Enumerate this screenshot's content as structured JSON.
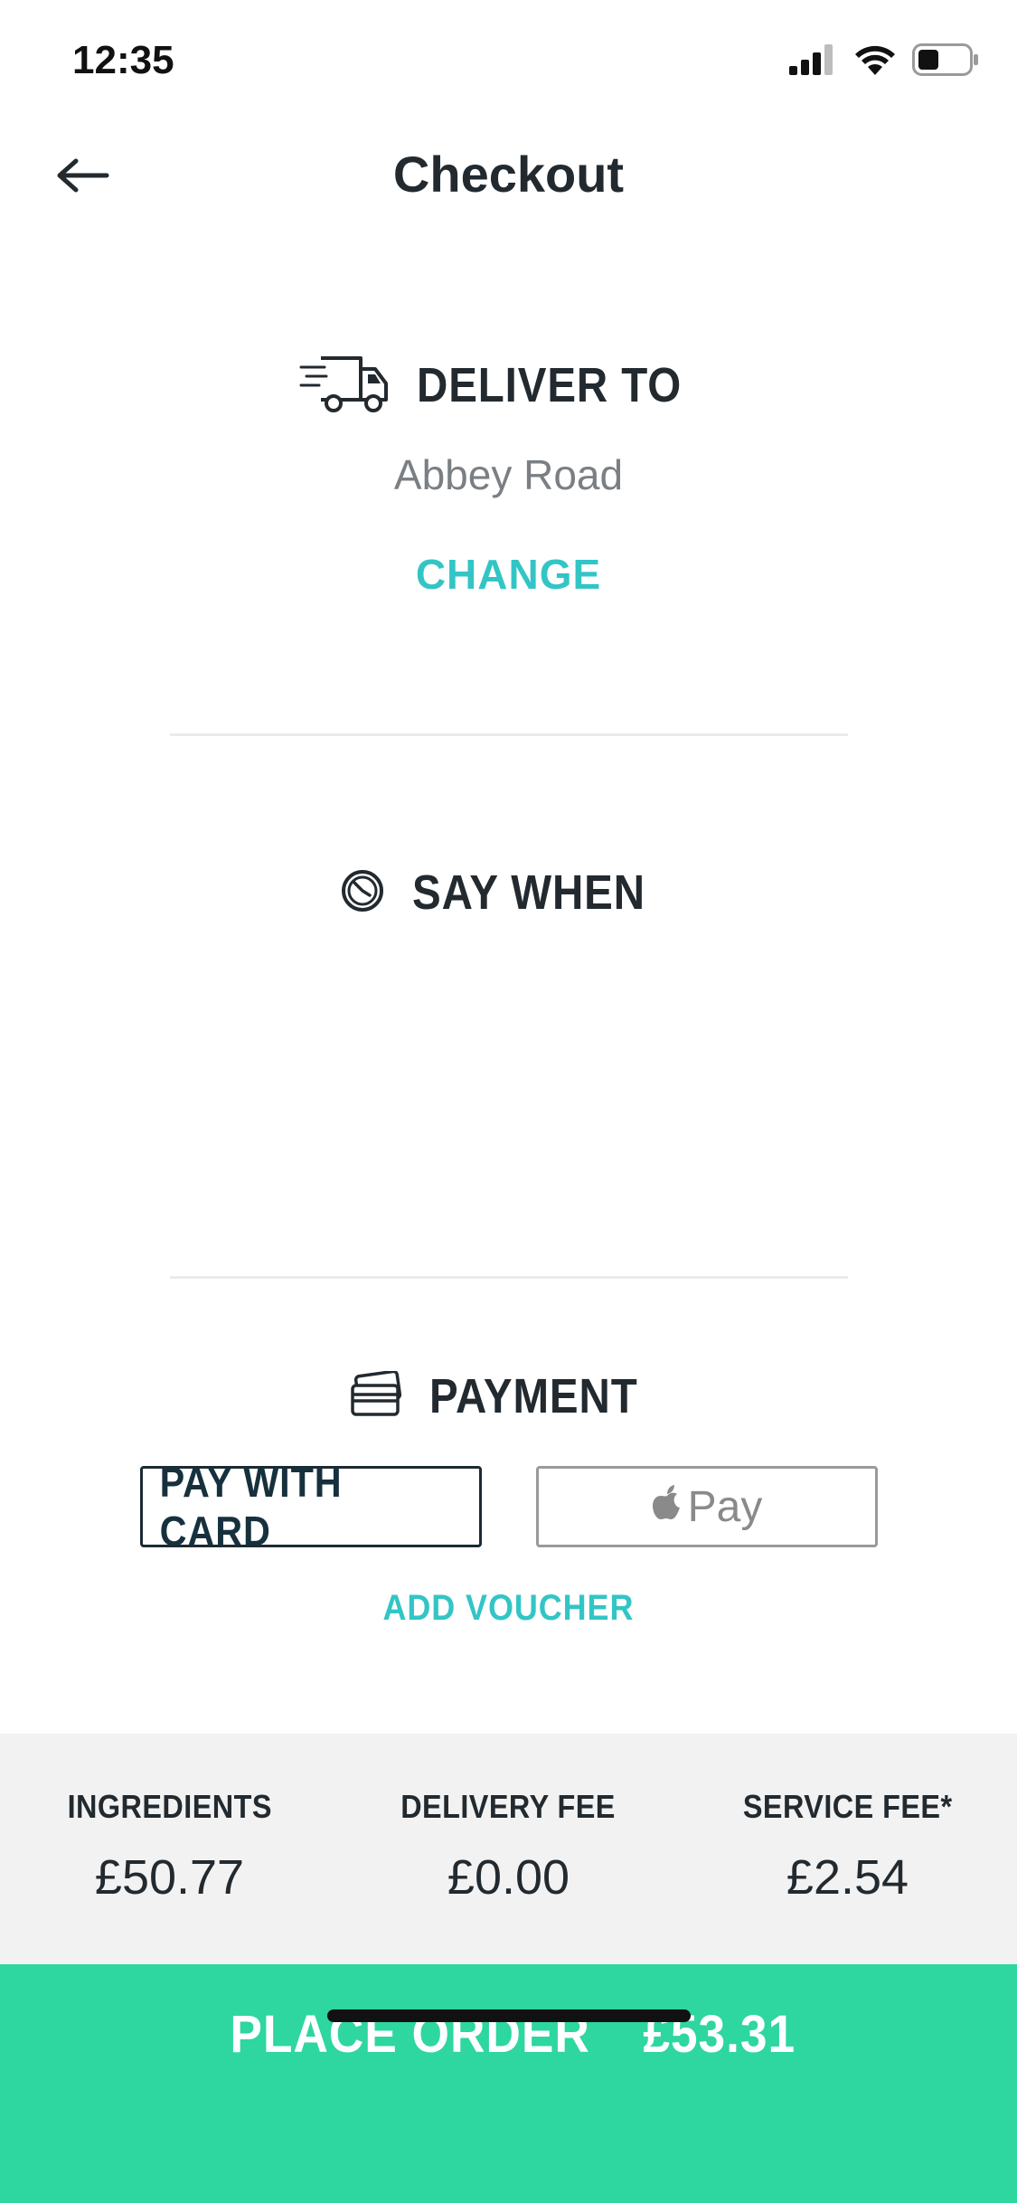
{
  "status_bar": {
    "time": "12:35",
    "icons": [
      "signal-icon",
      "wifi-icon",
      "battery-icon"
    ]
  },
  "nav": {
    "back_icon": "arrow-left-icon",
    "title": "Checkout"
  },
  "deliver": {
    "icon": "delivery-truck-icon",
    "title": "DELIVER TO",
    "address": "Abbey Road",
    "change_label": "CHANGE"
  },
  "say_when": {
    "icon": "clock-icon",
    "title": "SAY WHEN"
  },
  "payment": {
    "icon": "credit-card-icon",
    "title": "PAYMENT",
    "card_button": "PAY WITH CARD",
    "apple_pay_icon": "apple-icon",
    "apple_pay_label": "Pay",
    "voucher_label": "ADD VOUCHER"
  },
  "summary": {
    "items": [
      {
        "label": "INGREDIENTS",
        "value": "£50.77"
      },
      {
        "label": "DELIVERY FEE",
        "value": "£0.00"
      },
      {
        "label": "SERVICE FEE*",
        "value": "£2.54"
      }
    ]
  },
  "place_order": {
    "label": "PLACE ORDER",
    "total": "£53.31"
  },
  "colors": {
    "accent": "#33c5c5",
    "place_order_bg": "#2ed6a0",
    "text_dark": "#222a30",
    "summary_bg": "#f2f2f2"
  }
}
